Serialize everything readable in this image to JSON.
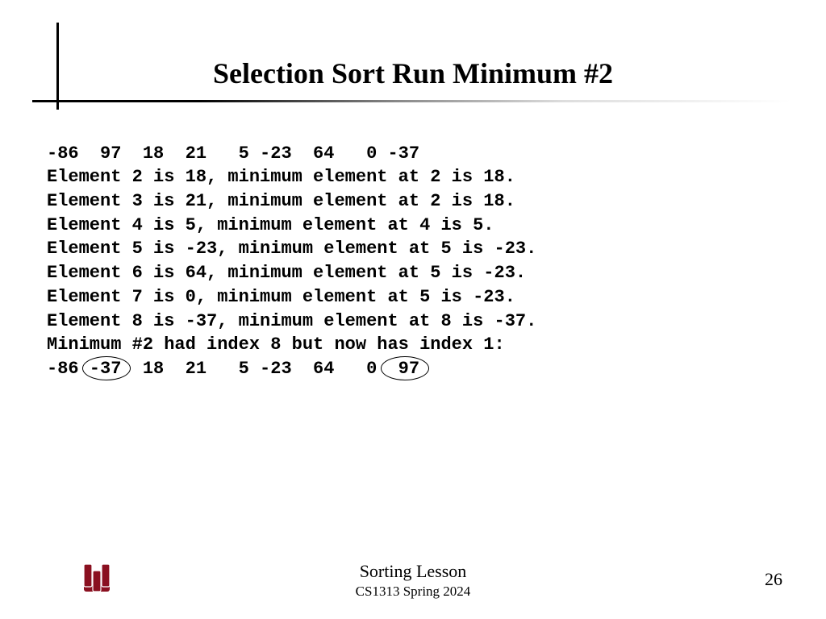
{
  "title": "Selection Sort Run Minimum #2",
  "body": {
    "row1": "-86  97  18  21   5 -23  64   0 -37",
    "l1": "Element 2 is 18, minimum element at 2 is 18.",
    "l2": "Element 3 is 21, minimum element at 2 is 18.",
    "l3": "Element 4 is 5, minimum element at 4 is 5.",
    "l4": "Element 5 is -23, minimum element at 5 is -23.",
    "l5": "Element 6 is 64, minimum element at 5 is -23.",
    "l6": "Element 7 is 0, minimum element at 5 is -23.",
    "l7": "Element 8 is -37, minimum element at 8 is -37.",
    "l8": "Minimum #2 had index 8 but now has index 1:",
    "row2": "-86 -37  18  21   5 -23  64   0  97"
  },
  "footer": {
    "lesson": "Sorting Lesson",
    "course": "CS1313 Spring 2024",
    "page": "26"
  }
}
